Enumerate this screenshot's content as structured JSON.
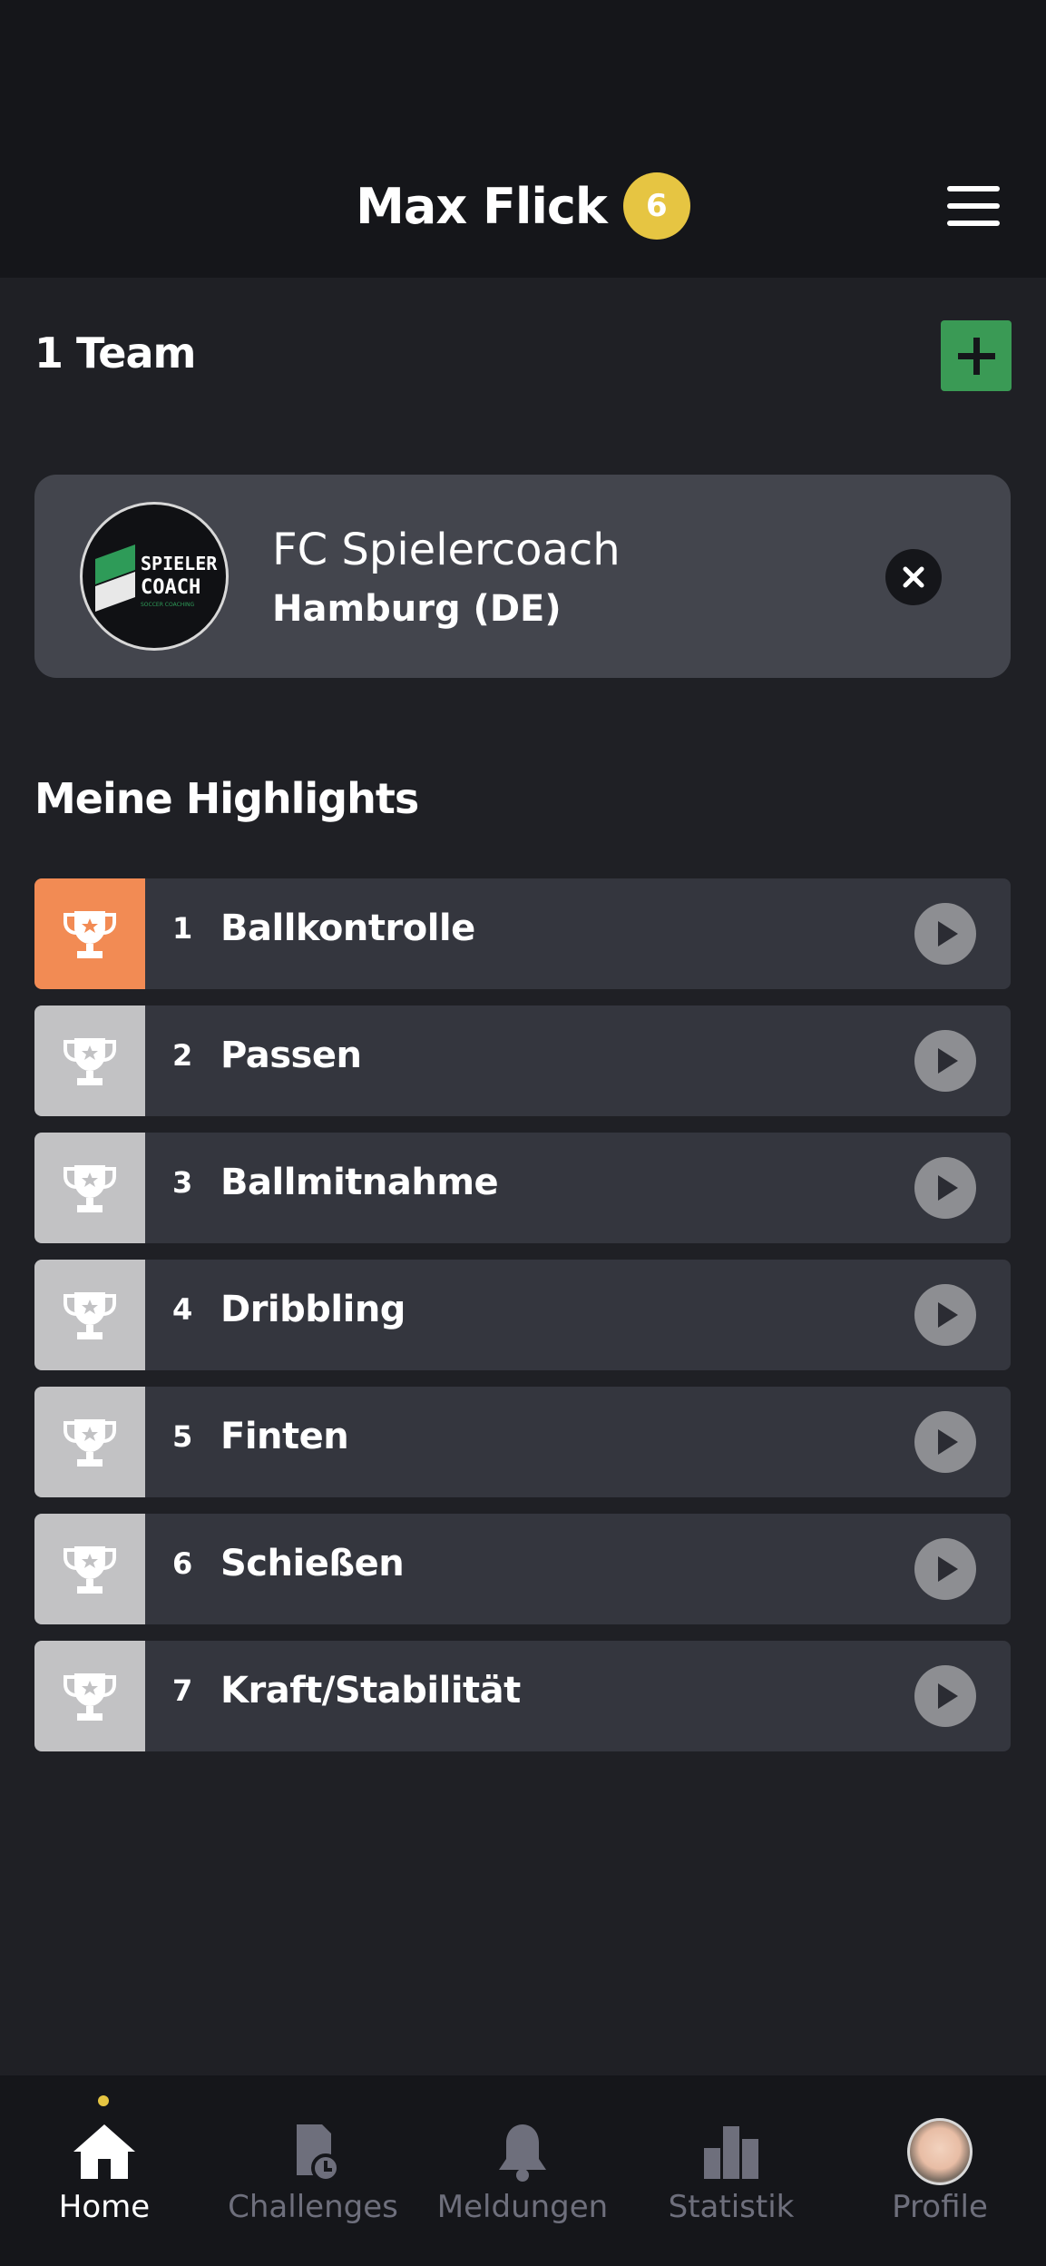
{
  "header": {
    "user_name": "Max Flick",
    "level": "6",
    "menu_icon": "hamburger-menu-icon"
  },
  "teams": {
    "heading": "1 Team",
    "add_icon": "plus-icon",
    "items": [
      {
        "name": "FC Spielercoach",
        "location": "Hamburg (DE)",
        "logo_text_top": "SPIELER",
        "logo_text_bottom": "COACH",
        "logo_tagline": "SOCCER COACHING"
      }
    ]
  },
  "highlights": {
    "heading": "Meine Highlights",
    "items": [
      {
        "rank": "1",
        "label": "Ballkontrolle",
        "active": true
      },
      {
        "rank": "2",
        "label": "Passen",
        "active": false
      },
      {
        "rank": "3",
        "label": "Ballmitnahme",
        "active": false
      },
      {
        "rank": "4",
        "label": "Dribbling",
        "active": false
      },
      {
        "rank": "5",
        "label": "Finten",
        "active": false
      },
      {
        "rank": "6",
        "label": "Schießen",
        "active": false
      },
      {
        "rank": "7",
        "label": "Kraft/Stabilität",
        "active": false
      }
    ]
  },
  "nav": {
    "items": [
      {
        "label": "Home",
        "icon": "home-icon",
        "active": true
      },
      {
        "label": "Challenges",
        "icon": "challenges-icon",
        "active": false
      },
      {
        "label": "Meldungen",
        "icon": "bell-icon",
        "active": false
      },
      {
        "label": "Statistik",
        "icon": "bar-chart-icon",
        "active": false
      },
      {
        "label": "Profile",
        "icon": "avatar",
        "active": false
      }
    ]
  },
  "colors": {
    "header_bg": "#15161a",
    "page_bg": "#1f2025",
    "badge": "#e6c542",
    "add_button": "#3a9a55",
    "trophy_active": "#f28b54",
    "trophy_inactive": "#c2c2c4",
    "nav_inactive": "#6e6f7c"
  }
}
